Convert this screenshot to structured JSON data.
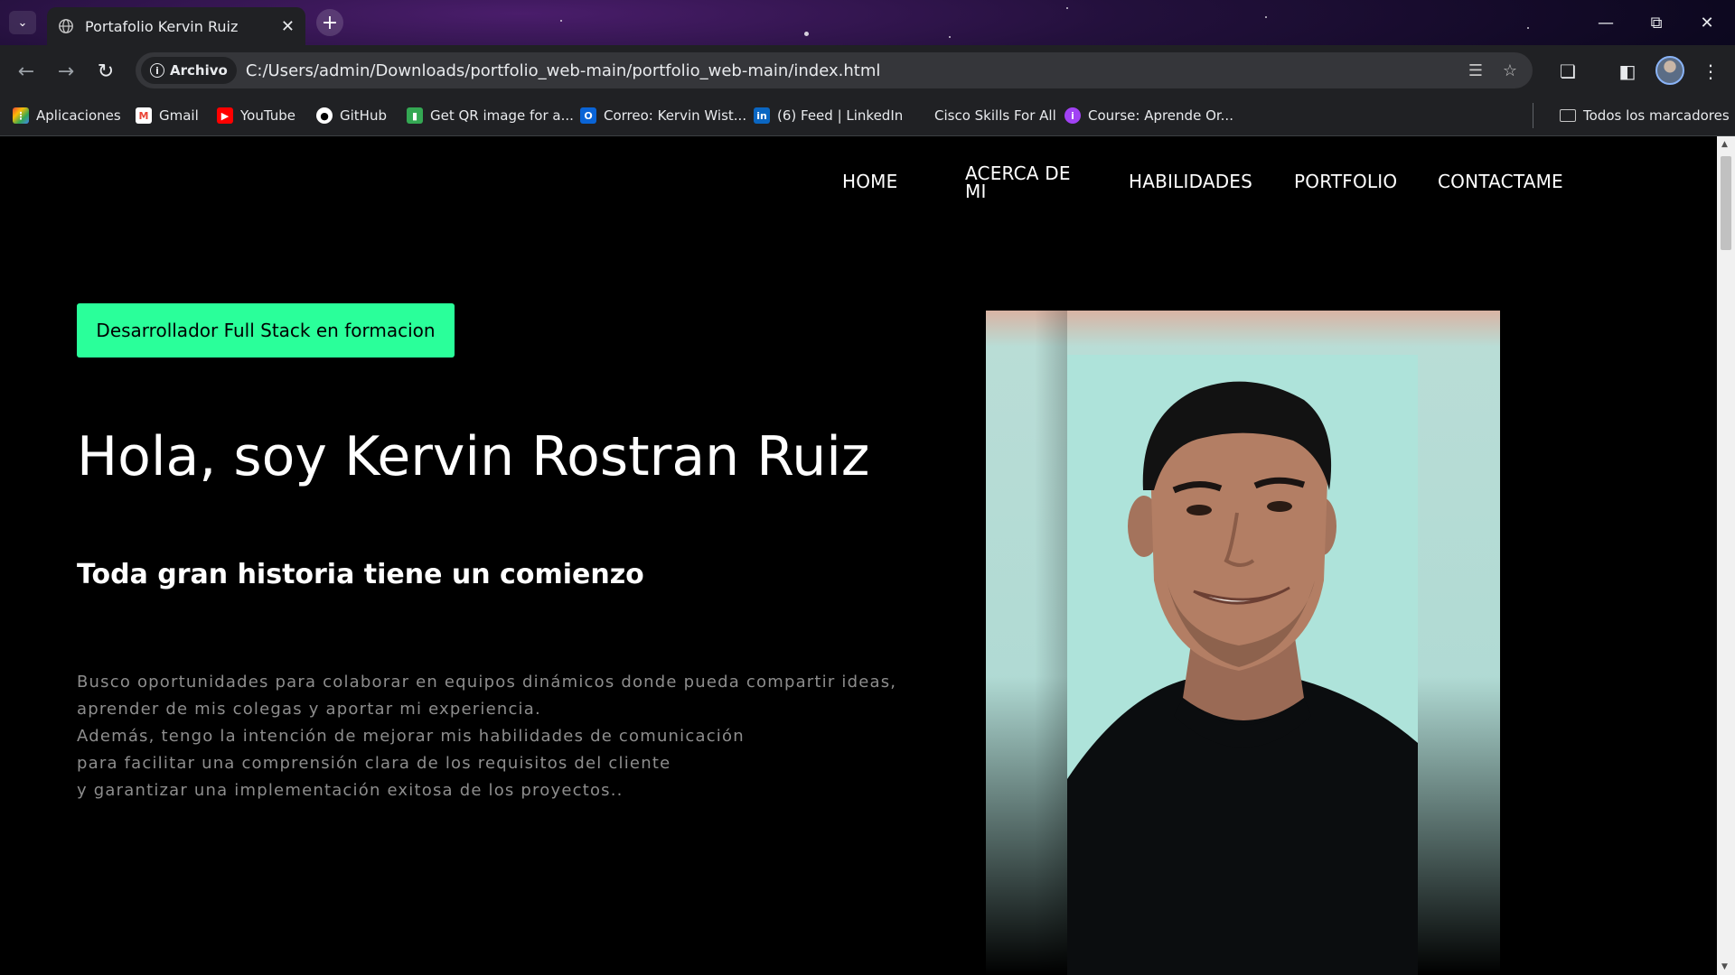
{
  "browser": {
    "tab_title": "Portafolio Kervin Ruiz",
    "site_chip": "Archivo",
    "url": "C:/Users/admin/Downloads/portfolio_web-main/portfolio_web-main/index.html",
    "bookmarks": [
      {
        "label": "Aplicaciones",
        "icon": "apps-grid-icon"
      },
      {
        "label": "Gmail",
        "icon": "gmail-icon"
      },
      {
        "label": "YouTube",
        "icon": "youtube-icon"
      },
      {
        "label": "GitHub",
        "icon": "github-icon"
      },
      {
        "label": "Get QR image for a...",
        "icon": "qr-chart-icon"
      },
      {
        "label": "Correo: Kervin Wist...",
        "icon": "outlook-icon"
      },
      {
        "label": "(6) Feed | LinkedIn",
        "icon": "linkedin-icon"
      },
      {
        "label": "Cisco Skills For All",
        "icon": "cisco-icon"
      },
      {
        "label": "Course: Aprende Or...",
        "icon": "course-icon"
      }
    ],
    "all_bookmarks": "Todos los marcadores"
  },
  "nav": {
    "home": "HOME",
    "about": "ACERCA DE MI",
    "skills": "HABILIDADES",
    "portfolio": "PORTFOLIO",
    "contact": "CONTACTAME"
  },
  "hero": {
    "badge": "Desarrollador Full Stack en formacion",
    "title": "Hola, soy Kervin Rostran Ruiz",
    "subtitle": "Toda gran historia tiene un comienzo",
    "paragraph_lines": [
      "Busco oportunidades para colaborar en equipos dinámicos donde pueda compartir ideas,",
      "aprender de mis colegas y aportar mi experiencia.",
      "Además, tengo la intención de mejorar mis habilidades de comunicación",
      "para facilitar una comprensión clara de los requisitos del cliente",
      "y garantizar una implementación exitosa de los proyectos.."
    ]
  },
  "colors": {
    "accent": "#2aff9a",
    "page_bg": "#000000",
    "chrome_bg": "#202124"
  }
}
